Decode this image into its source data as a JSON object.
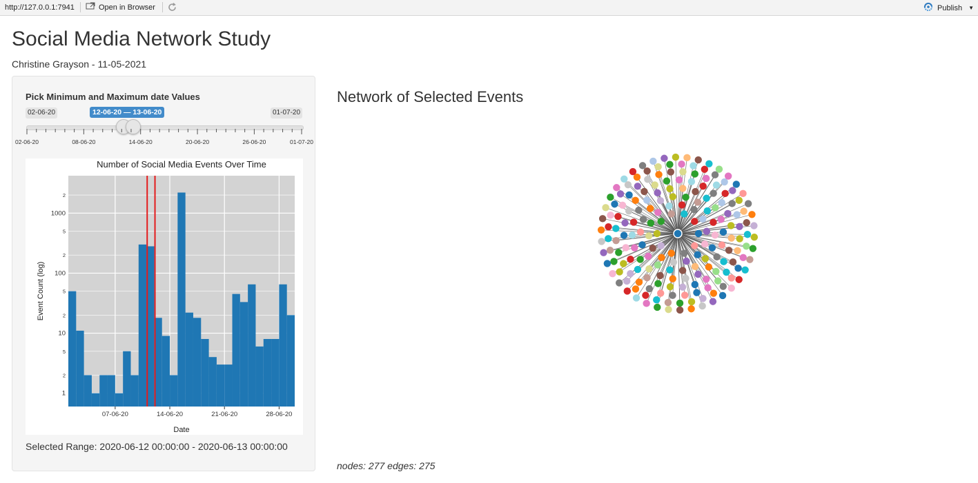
{
  "toolbar": {
    "url": "http://127.0.0.1:7941",
    "open_in_browser": "Open in Browser",
    "publish": "Publish"
  },
  "page": {
    "title": "Social Media Network Study",
    "subtitle": "Christine Grayson - 11-05-2021"
  },
  "slider": {
    "label": "Pick Minimum and Maximum date Values",
    "min_label": "02-06-20",
    "max_label": "01-07-20",
    "selected_label": "12-06-20 — 13-06-20",
    "ticks": [
      "02-06-20",
      "08-06-20",
      "14-06-20",
      "20-06-20",
      "26-06-20",
      "01-07-20"
    ]
  },
  "chart_data": {
    "type": "bar",
    "title": "Number of Social Media Events Over Time",
    "xlabel": "Date",
    "ylabel": "Event Count (log)",
    "log_scale": true,
    "grid": true,
    "x_tick_labels": [
      "07-06-20",
      "14-06-20",
      "21-06-20",
      "28-06-20"
    ],
    "y_tick_labels": [
      "1",
      "2",
      "5",
      "10",
      "2",
      "5",
      "100",
      "2",
      "5",
      "1000",
      "2"
    ],
    "x": [
      "2020-06-02",
      "2020-06-03",
      "2020-06-04",
      "2020-06-05",
      "2020-06-06",
      "2020-06-07",
      "2020-06-08",
      "2020-06-09",
      "2020-06-10",
      "2020-06-11",
      "2020-06-12",
      "2020-06-13",
      "2020-06-14",
      "2020-06-15",
      "2020-06-16",
      "2020-06-17",
      "2020-06-18",
      "2020-06-19",
      "2020-06-20",
      "2020-06-21",
      "2020-06-22",
      "2020-06-23",
      "2020-06-24",
      "2020-06-25",
      "2020-06-26",
      "2020-06-27",
      "2020-06-28",
      "2020-06-29",
      "2020-06-30"
    ],
    "values": [
      50,
      11,
      2,
      1,
      2,
      2,
      1,
      5,
      2,
      300,
      280,
      18,
      9,
      2,
      2200,
      22,
      18,
      8,
      4,
      3,
      3,
      45,
      33,
      65,
      6,
      8,
      8,
      65,
      20
    ],
    "selected_range": [
      "2020-06-12",
      "2020-06-13"
    ],
    "bar_color": "#1f77b4",
    "marker_color": "#e41a1c"
  },
  "selected_range_text": "Selected Range: 2020-06-12 00:00:00 - 2020-06-13 00:00:00",
  "network": {
    "title": "Network of Selected Events",
    "stats": "nodes: 277 edges: 275",
    "palette": [
      "#1f77b4",
      "#aec7e8",
      "#ff7f0e",
      "#ffbb78",
      "#2ca02c",
      "#98df8a",
      "#d62728",
      "#ff9896",
      "#9467bd",
      "#c5b0d5",
      "#8c564b",
      "#c49c94",
      "#e377c2",
      "#f7b6d2",
      "#7f7f7f",
      "#c7c7c7",
      "#bcbd22",
      "#dbdb8d",
      "#17becf",
      "#9edae5"
    ]
  }
}
